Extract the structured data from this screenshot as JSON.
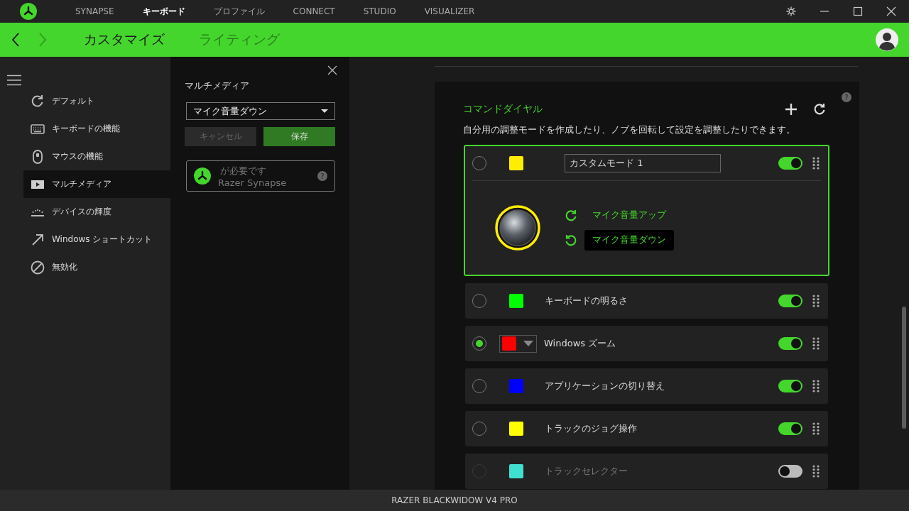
{
  "top_nav": [
    {
      "label": "SYNAPSE",
      "selected": false
    },
    {
      "label": "キーボード",
      "selected": true
    },
    {
      "label": "プロファイル",
      "selected": false
    },
    {
      "label": "CONNECT",
      "selected": false
    },
    {
      "label": "STUDIO",
      "selected": false
    },
    {
      "label": "VISUALIZER",
      "selected": false
    }
  ],
  "sub_tabs": [
    {
      "label": "カスタマイズ",
      "selected": true
    },
    {
      "label": "ライティング",
      "selected": false
    }
  ],
  "sidebar": {
    "items": [
      {
        "kind": "default",
        "label": "デフォルト",
        "selected": false
      },
      {
        "kind": "keyboard",
        "label": "キーボードの機能",
        "selected": false
      },
      {
        "kind": "mouse",
        "label": "マウスの機能",
        "selected": false
      },
      {
        "kind": "multimedia",
        "label": "マルチメディア",
        "selected": true
      },
      {
        "kind": "brightness",
        "label": "デバイスの輝度",
        "selected": false
      },
      {
        "kind": "shortcut",
        "label": "Windows ショートカット",
        "selected": false
      },
      {
        "kind": "disable",
        "label": "無効化",
        "selected": false
      }
    ]
  },
  "panel": {
    "title": "マルチメディア",
    "dropdown_value": "マイク音量ダウン",
    "buttons": [
      {
        "kind": "cancel",
        "label": "キャンセル",
        "disabled": true
      },
      {
        "kind": "save",
        "label": "保存",
        "disabled": false
      }
    ],
    "notice": {
      "line_1": "が必要です",
      "line_2": "Razer Synapse",
      "help": "?"
    }
  },
  "command_dial": {
    "help": "?",
    "title": "コマンドダイヤル",
    "description": "自分用の調整モードを作成したり、ノブを回転して設定を調整したりできます。",
    "modes": [
      {
        "name": "カスタムモード 1",
        "color": "#ffee00",
        "selected": false,
        "on": true,
        "expanded": true,
        "color_dropdown": false,
        "actions": [
          {
            "kind": "clockwise",
            "label": "マイク音量アップ",
            "selected": false
          },
          {
            "kind": "counterclockwise",
            "label": "マイク音量ダウン",
            "selected": true
          }
        ]
      },
      {
        "name": "キーボードの明るさ",
        "color": "#00ff00",
        "selected": false,
        "on": true,
        "expanded": false,
        "color_dropdown": false
      },
      {
        "name": "Windows ズーム",
        "color": "#ff0000",
        "selected": true,
        "on": true,
        "expanded": false,
        "color_dropdown": true
      },
      {
        "name": "アプリケーションの切り替え",
        "color": "#0000ff",
        "selected": false,
        "on": true,
        "expanded": false,
        "color_dropdown": false
      },
      {
        "name": "トラックのジョグ操作",
        "color": "#ffff00",
        "selected": false,
        "on": true,
        "expanded": false,
        "color_dropdown": false
      },
      {
        "name": "トラックセレクター",
        "color": "#40e0d0",
        "selected": false,
        "on": false,
        "expanded": false,
        "color_dropdown": false
      }
    ]
  },
  "status_bar": {
    "device": "RAZER BLACKWIDOW V4 PRO"
  }
}
